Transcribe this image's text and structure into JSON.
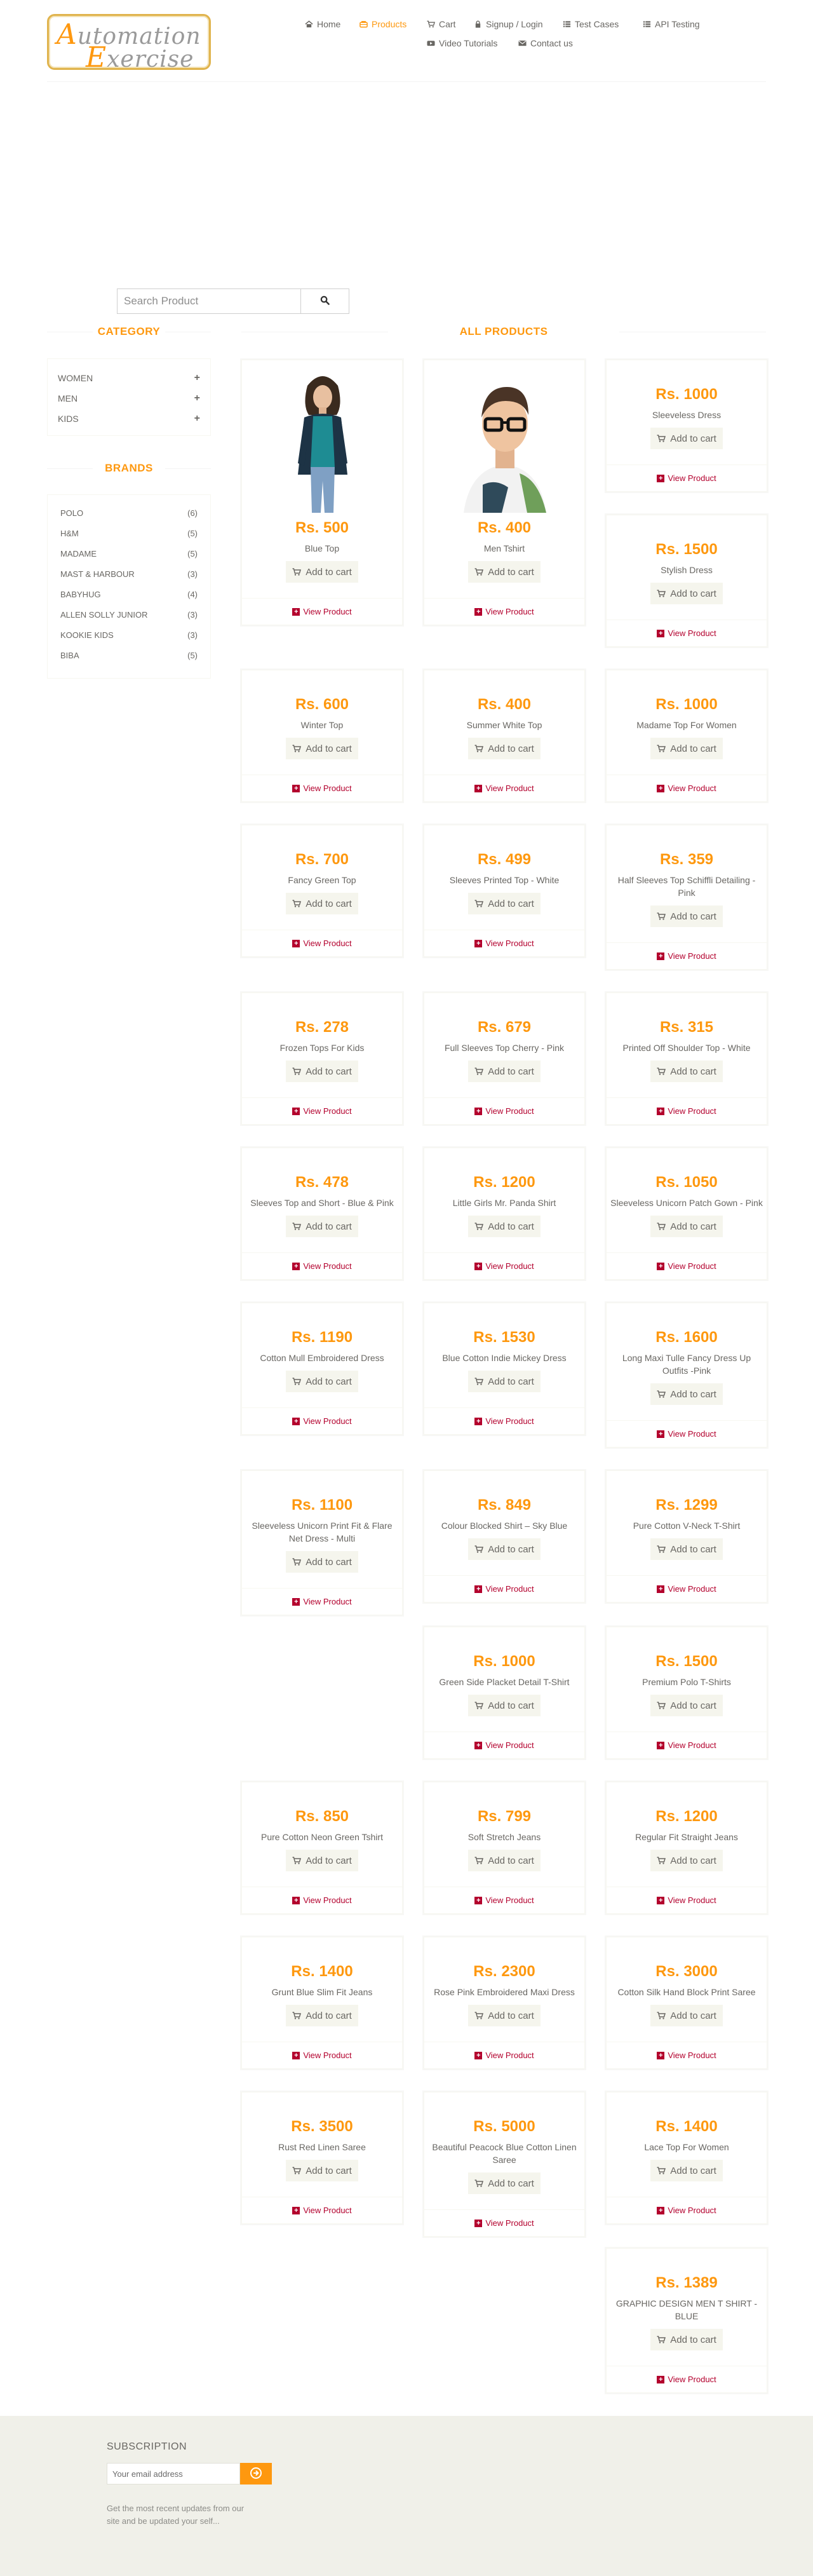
{
  "header": {
    "logo_first": "utomation",
    "logo_first_cap": "A",
    "logo_second": "xercise",
    "logo_second_cap": "E",
    "nav": [
      {
        "label": "Home",
        "icon": "home-icon"
      },
      {
        "label": "Products",
        "icon": "products-icon",
        "active": true
      },
      {
        "label": "Cart",
        "icon": "cart-icon"
      },
      {
        "label": "Signup / Login",
        "icon": "lock-icon"
      },
      {
        "label": "Test Cases",
        "icon": "list-icon"
      },
      {
        "label": "API Testing",
        "icon": "list-icon"
      },
      {
        "label": "Video Tutorials",
        "icon": "video-icon"
      },
      {
        "label": "Contact us",
        "icon": "envelope-icon"
      }
    ]
  },
  "search": {
    "placeholder": "Search Product"
  },
  "sidebar": {
    "category_title": "CATEGORY",
    "categories": [
      {
        "label": "WOMEN"
      },
      {
        "label": "MEN"
      },
      {
        "label": "KIDS"
      }
    ],
    "brands_title": "BRANDS",
    "brands": [
      {
        "name": "POLO",
        "count": "(6)"
      },
      {
        "name": "H&M",
        "count": "(5)"
      },
      {
        "name": "MADAME",
        "count": "(5)"
      },
      {
        "name": "MAST & HARBOUR",
        "count": "(3)"
      },
      {
        "name": "BABYHUG",
        "count": "(4)"
      },
      {
        "name": "ALLEN SOLLY JUNIOR",
        "count": "(3)"
      },
      {
        "name": "KOOKIE KIDS",
        "count": "(3)"
      },
      {
        "name": "BIBA",
        "count": "(5)"
      }
    ]
  },
  "products_title": "ALL PRODUCTS",
  "add_to_cart_label": "Add to cart",
  "view_product_label": "View Product",
  "products": [
    {
      "price": "Rs. 500",
      "name": "Blue Top"
    },
    {
      "price": "Rs. 400",
      "name": "Men Tshirt"
    },
    {
      "price": "Rs. 1000",
      "name": "Sleeveless Dress"
    },
    {
      "price": "Rs. 1500",
      "name": "Stylish Dress"
    },
    {
      "price": "Rs. 600",
      "name": "Winter Top"
    },
    {
      "price": "Rs. 400",
      "name": "Summer White Top"
    },
    {
      "price": "Rs. 1000",
      "name": "Madame Top For Women"
    },
    {
      "price": "Rs. 700",
      "name": "Fancy Green Top"
    },
    {
      "price": "Rs. 499",
      "name": "Sleeves Printed Top - White"
    },
    {
      "price": "Rs. 359",
      "name": "Half Sleeves Top Schiffli Detailing - Pink"
    },
    {
      "price": "Rs. 278",
      "name": "Frozen Tops For Kids"
    },
    {
      "price": "Rs. 679",
      "name": "Full Sleeves Top Cherry - Pink"
    },
    {
      "price": "Rs. 315",
      "name": "Printed Off Shoulder Top - White"
    },
    {
      "price": "Rs. 478",
      "name": "Sleeves Top and Short - Blue & Pink"
    },
    {
      "price": "Rs. 1200",
      "name": "Little Girls Mr. Panda Shirt"
    },
    {
      "price": "Rs. 1050",
      "name": "Sleeveless Unicorn Patch Gown - Pink"
    },
    {
      "price": "Rs. 1190",
      "name": "Cotton Mull Embroidered Dress"
    },
    {
      "price": "Rs. 1530",
      "name": "Blue Cotton Indie Mickey Dress"
    },
    {
      "price": "Rs. 1600",
      "name": "Long Maxi Tulle Fancy Dress Up Outfits -Pink"
    },
    {
      "price": "Rs. 1100",
      "name": "Sleeveless Unicorn Print Fit & Flare Net Dress - Multi"
    },
    {
      "price": "Rs. 849",
      "name": "Colour Blocked Shirt – Sky Blue"
    },
    {
      "price": "Rs. 1299",
      "name": "Pure Cotton V-Neck T-Shirt"
    },
    {
      "price": "Rs. 1000",
      "name": "Green Side Placket Detail T-Shirt"
    },
    {
      "price": "Rs. 1500",
      "name": "Premium Polo T-Shirts"
    },
    {
      "price": "Rs. 850",
      "name": "Pure Cotton Neon Green Tshirt"
    },
    {
      "price": "Rs. 799",
      "name": "Soft Stretch Jeans"
    },
    {
      "price": "Rs. 1200",
      "name": "Regular Fit Straight Jeans"
    },
    {
      "price": "Rs. 1400",
      "name": "Grunt Blue Slim Fit Jeans"
    },
    {
      "price": "Rs. 2300",
      "name": "Rose Pink Embroidered Maxi Dress"
    },
    {
      "price": "Rs. 3000",
      "name": "Cotton Silk Hand Block Print Saree"
    },
    {
      "price": "Rs. 3500",
      "name": "Rust Red Linen Saree"
    },
    {
      "price": "Rs. 5000",
      "name": "Beautiful Peacock Blue Cotton Linen Saree"
    },
    {
      "price": "Rs. 1400",
      "name": "Lace Top For Women"
    },
    {
      "price": "Rs. 1389",
      "name": "GRAPHIC DESIGN MEN T SHIRT - BLUE"
    }
  ],
  "footer": {
    "subscription_title": "SUBSCRIPTION",
    "email_placeholder": "Your email address",
    "note": "Get the most recent updates from our site and be updated your self..."
  },
  "colors": {
    "accent": "#fe980f",
    "link": "#b3002d",
    "footer_bg": "#f0f0e9"
  }
}
